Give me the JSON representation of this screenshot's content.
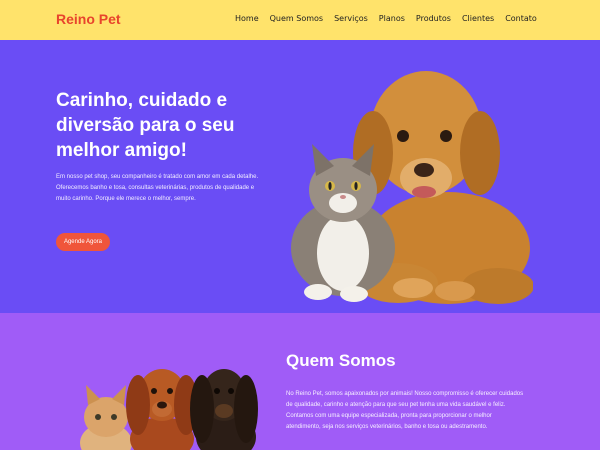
{
  "navbar": {
    "brand": "Reino Pet",
    "links": [
      "Home",
      "Quem Somos",
      "Serviços",
      "Planos",
      "Produtos",
      "Clientes",
      "Contato"
    ]
  },
  "hero": {
    "title": "Carinho, cuidado e diversão para o seu melhor amigo!",
    "text": "Em nosso pet shop, seu companheiro é tratado com amor em cada detalhe. Oferecemos banho e tosa, consultas veterinárias, produtos de qualidade e muito carinho. Porque ele merece o melhor, sempre.",
    "cta_label": "Agende Agora",
    "image_alt": "cat and golden retriever"
  },
  "about": {
    "title": "Quem Somos",
    "text": "No Reino Pet, somos apaixonados por animais! Nosso compromisso é oferecer cuidados de qualidade, carinho e atenção para que seu pet tenha uma vida saudável e feliz. Contamos com uma equipe especializada, pronta para proporcionar o melhor atendimento, seja nos serviços veterinários, banho e tosa ou adestramento.",
    "image_alt": "cat and dogs"
  },
  "colors": {
    "navbar_bg": "#ffe36b",
    "brand": "#e8442c",
    "hero_bg": "#6a4df5",
    "about_bg": "#a05cf7",
    "cta_bg": "#f0553a"
  }
}
